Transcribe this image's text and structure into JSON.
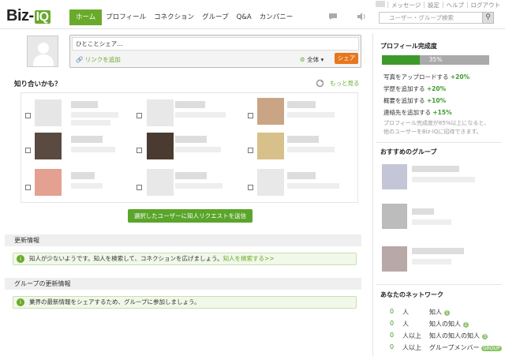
{
  "header": {
    "logo_main": "Biz-",
    "logo_accent": "IQ",
    "nav": [
      "ホーム",
      "プロフィール",
      "コネクション",
      "グループ",
      "Q&A",
      "カンパニー"
    ],
    "top_links": [
      "メッセージ",
      "設定",
      "ヘルプ",
      "ログアウト"
    ],
    "search_placeholder": "ユーザー・グループ検索"
  },
  "post": {
    "placeholder": "ひとことシェア…",
    "link_add": "リンクを追加",
    "scope": "全体",
    "share": "シェア"
  },
  "people": {
    "title": "知り合いかも？",
    "more": "もっと見る",
    "send_button": "選択したユーザーに知人リクエストを送信"
  },
  "updates": {
    "title": "更新情報",
    "message": "知人が少ないようです。知人を検索して、コネクションを広げましょう。",
    "link": "知人を検索する>>"
  },
  "group_updates": {
    "title": "グループの更新情報",
    "message": "業界の最新情報をシェアするため、グループに参加しましょう。"
  },
  "profile": {
    "title": "プロフィール完成度",
    "percent_label": "35%",
    "percent": 35,
    "items": [
      {
        "label": "写真をアップロードする",
        "bonus": "+20%"
      },
      {
        "label": "学歴を追加する",
        "bonus": "+20%"
      },
      {
        "label": "概要を追加する",
        "bonus": "+10%"
      },
      {
        "label": "連絡先を追加する",
        "bonus": "+15%"
      }
    ],
    "note": "プロフィール完成度が85%以上になると、他のユーザーをBiz-IQに招待できます。"
  },
  "recommended": {
    "title": "おすすめのグループ"
  },
  "network": {
    "title": "あなたのネットワーク",
    "rows": [
      {
        "count": "0",
        "unit": "人",
        "label": "知人",
        "badge": "1"
      },
      {
        "count": "0",
        "unit": "人",
        "label": "知人の知人",
        "badge": "2"
      },
      {
        "count": "0",
        "unit": "人以上",
        "label": "知人の知人の知人",
        "badge": "3"
      },
      {
        "count": "0",
        "unit": "人以上",
        "label": "グループメンバー",
        "badge": "GROUP"
      }
    ]
  },
  "colors": {
    "accent": "#6aaa2b",
    "share": "#e8761c"
  }
}
